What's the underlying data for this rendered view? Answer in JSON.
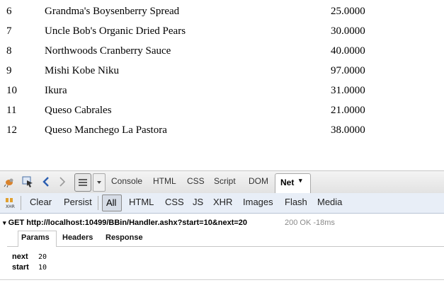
{
  "products": [
    {
      "id": "6",
      "name": "Grandma's Boysenberry Spread",
      "price": "25.0000"
    },
    {
      "id": "7",
      "name": "Uncle Bob's Organic Dried Pears",
      "price": "30.0000"
    },
    {
      "id": "8",
      "name": "Northwoods Cranberry Sauce",
      "price": "40.0000"
    },
    {
      "id": "9",
      "name": "Mishi Kobe Niku",
      "price": "97.0000"
    },
    {
      "id": "10",
      "name": "Ikura",
      "price": "31.0000"
    },
    {
      "id": "11",
      "name": "Queso Cabrales",
      "price": "21.0000"
    },
    {
      "id": "12",
      "name": "Queso Manchego La Pastora",
      "price": "38.0000"
    }
  ],
  "firebug": {
    "tabs": [
      "Console",
      "HTML",
      "CSS",
      "Script",
      "DOM"
    ],
    "active_tab": "Net",
    "net_toolbar": {
      "clear": "Clear",
      "persist": "Persist",
      "filters": [
        "All",
        "HTML",
        "CSS",
        "JS",
        "XHR",
        "Images",
        "Flash",
        "Media"
      ]
    },
    "request": {
      "line": "GET http://localhost:10499/BBin/Handler.ashx?start=10&next=20",
      "status": "200 OK",
      "time": "-18ms",
      "subtabs": [
        "Params",
        "Headers",
        "Response"
      ],
      "params": [
        {
          "name": "next",
          "value": "20"
        },
        {
          "name": "start",
          "value": "10"
        }
      ]
    }
  },
  "colors": {
    "toolbar": "#e2e2e2",
    "net_toolbar": "#e8eef7",
    "accent": "#2a5db0"
  }
}
